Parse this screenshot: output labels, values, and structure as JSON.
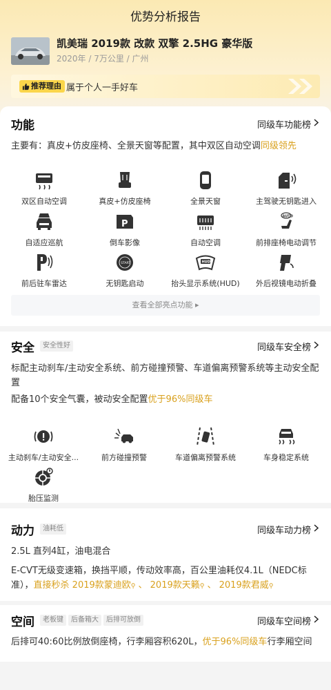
{
  "page_title": "优势分析报告",
  "car": {
    "name": "凯美瑞 2019款 改款 双擎 2.5HG 豪华版",
    "meta": "2020年 / 7万公里 / 广州"
  },
  "reason": {
    "badge": "推荐理由",
    "text": "属于个人一手好车"
  },
  "function": {
    "title": "功能",
    "link": "同级车功能榜",
    "desc_prefix": "主要有：真皮+仿皮座椅、全景天窗等配置，其中双区自动空调",
    "desc_highlight": "同级领先",
    "items": [
      {
        "label": "双区自动空调",
        "icon": "dual-ac-icon"
      },
      {
        "label": "真皮+仿皮座椅",
        "icon": "seat-icon"
      },
      {
        "label": "全景天窗",
        "icon": "sunroof-icon"
      },
      {
        "label": "主驾驶无钥匙进入",
        "icon": "keyless-entry-icon"
      },
      {
        "label": "自适应巡航",
        "icon": "adaptive-cruise-icon"
      },
      {
        "label": "倒车影像",
        "icon": "reverse-camera-icon"
      },
      {
        "label": "自动空调",
        "icon": "auto-ac-icon"
      },
      {
        "label": "前排座椅电动调节",
        "icon": "power-seat-icon"
      },
      {
        "label": "前后驻车雷达",
        "icon": "parking-radar-icon"
      },
      {
        "label": "无钥匙启动",
        "icon": "keyless-start-icon"
      },
      {
        "label": "抬头显示系统(HUD)",
        "icon": "hud-icon"
      },
      {
        "label": "外后视镜电动折叠",
        "icon": "mirror-fold-icon"
      }
    ],
    "more_label": "查看全部亮点功能"
  },
  "safety": {
    "title": "安全",
    "tag": "安全性好",
    "link": "同级车安全榜",
    "desc1": "标配主动刹车/主动安全系统、前方碰撞预警、车道偏离预警系统等主动安全配置",
    "desc2_prefix": "配备10个安全气囊，被动安全配置",
    "desc2_highlight": "优于96%同级车",
    "items": [
      {
        "label": "主动刹车/主动安全...",
        "icon": "active-brake-icon"
      },
      {
        "label": "前方碰撞预警",
        "icon": "collision-warning-icon"
      },
      {
        "label": "车道偏离预警系统",
        "icon": "lane-departure-icon"
      },
      {
        "label": "车身稳定系统",
        "icon": "stability-icon"
      },
      {
        "label": "胎压监测",
        "icon": "tire-pressure-icon"
      }
    ]
  },
  "power": {
    "title": "动力",
    "tag": "油耗低",
    "link": "同级车动力榜",
    "spec": "2.5L 直列4缸，油电混合",
    "desc_prefix": "E-CVT无级变速箱，换挡平顺，传动效率高，百公里油耗仅4.1L（NEDC标准），",
    "desc_highlight1": "直接秒杀",
    "desc_car1": "2019款蒙迪欧",
    "sep1": "、",
    "desc_car2": "2019款天籁",
    "sep2": "、",
    "desc_car3": "2019款君威"
  },
  "space": {
    "title": "空间",
    "tags": [
      "老板键",
      "后备箱大",
      "后排可放倒"
    ],
    "link": "同级车空间榜",
    "desc_prefix": "后排可40:60比例放倒座椅，行李厢容积620L，",
    "desc_highlight": "优于96%同级车",
    "desc_suffix": "行李厢空间"
  },
  "colors": {
    "accent": "#d9a11e",
    "hero_bg": "#fbe9b3",
    "badge": "#fbd64a"
  }
}
